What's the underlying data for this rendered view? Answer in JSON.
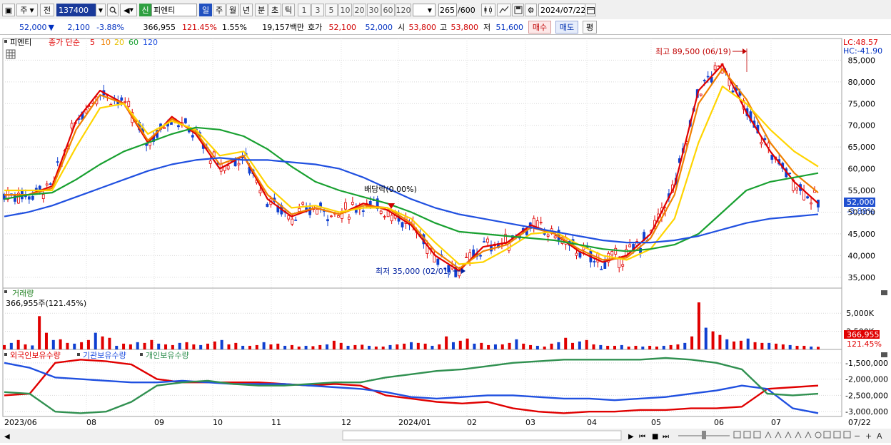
{
  "toolbar": {
    "market_label": "주",
    "prev_label": "전",
    "code_value": "137400",
    "sin_badge": "신",
    "name_value": "피엔티",
    "periods": [
      "일",
      "주",
      "월",
      "년",
      "분",
      "초",
      "틱"
    ],
    "intervals": [
      "1",
      "3",
      "5",
      "10",
      "20",
      "30",
      "60",
      "120"
    ],
    "count_value": "265",
    "count_total": "/600",
    "date_value": "2024/07/22"
  },
  "quote": {
    "price": "52,000",
    "change": "2,100",
    "change_pct": "-3.88%",
    "volume": "366,955",
    "volume_ratio": "121.45%",
    "turnover": "1.55%",
    "amount": "19,157백만",
    "ask_label": "호가",
    "ask_value": "52,100",
    "bid_value": "52,000",
    "open_label": "시",
    "open_value": "53,800",
    "high_label": "고",
    "high_value": "53,800",
    "low_label": "저",
    "low_value": "51,600",
    "buy_label": "매수",
    "sell_label": "매도",
    "eval_label": "평"
  },
  "price_panel": {
    "legend_name": "피엔티",
    "legend_ma": "종가 단순",
    "ma_periods": [
      "5",
      "10",
      "20",
      "60",
      "120"
    ],
    "ma_colors": [
      "#e00000",
      "#f08000",
      "#ffd400",
      "#18a030",
      "#2050e0"
    ],
    "lc_label": "LC:48.57",
    "hc_label": "HC:-41.90",
    "current_price_label": "52,000",
    "current_pct_label": "-3.88%",
    "high_annotation": "최고 89,500 (06/19)",
    "low_annotation": "최저 35,000 (02/01)",
    "dividend_annotation": "배당락(0.00%)"
  },
  "volume_panel": {
    "title": "거래량",
    "subtitle": "366,955주(121.45%)",
    "current_label": "366,955",
    "ratio_label": "121.45%"
  },
  "holding_panel": {
    "legend": [
      {
        "label": "외국인보유수량",
        "color": "#e00000"
      },
      {
        "label": "기관보유수량",
        "color": "#2050e0"
      },
      {
        "label": "개인보유수량",
        "color": "#309050"
      }
    ]
  },
  "chart_data": [
    {
      "type": "line",
      "title": "피엔티",
      "y_ticks": [
        35000,
        40000,
        45000,
        50000,
        55000,
        60000,
        65000,
        70000,
        75000,
        80000,
        85000
      ],
      "ylim": [
        32500,
        90000
      ],
      "x_labels": [
        "2023/06",
        "08",
        "09",
        "10",
        "11",
        "12",
        "2024/01",
        "02",
        "03",
        "04",
        "05",
        "06",
        "07",
        "07/22"
      ],
      "current_price": 52000,
      "period_high": 89500,
      "period_low": 35000,
      "series": [
        {
          "name": "5",
          "values": [
            54000,
            54000,
            56000,
            71000,
            78000,
            75000,
            66000,
            72000,
            68000,
            60000,
            63000,
            53000,
            49000,
            51000,
            49500,
            52000,
            50500,
            47000,
            40000,
            36500,
            42000,
            43000,
            47000,
            45000,
            41000,
            38500,
            40000,
            45000,
            56000,
            78000,
            84000,
            73000,
            64000,
            57000,
            52000
          ]
        },
        {
          "name": "10",
          "values": [
            54000,
            54000,
            55500,
            69000,
            77000,
            75000,
            66500,
            71500,
            68500,
            61000,
            63000,
            54000,
            49500,
            51000,
            49500,
            51500,
            51000,
            47500,
            41000,
            37000,
            41000,
            42500,
            46500,
            45000,
            41500,
            39000,
            39500,
            44000,
            54000,
            75000,
            83000,
            76000,
            66000,
            59000,
            54500
          ]
        },
        {
          "name": "20",
          "values": [
            55000,
            55000,
            55000,
            65000,
            74000,
            75000,
            68000,
            71000,
            69000,
            63000,
            64000,
            56000,
            51000,
            51500,
            50000,
            51000,
            51000,
            48500,
            43000,
            38000,
            38500,
            41500,
            45000,
            45500,
            42500,
            40000,
            39000,
            41500,
            48500,
            66000,
            79000,
            75000,
            69000,
            64000,
            60500
          ]
        },
        {
          "name": "60",
          "values": [
            53000,
            54000,
            54500,
            57500,
            61000,
            64000,
            66000,
            68000,
            69500,
            69000,
            67500,
            64500,
            60500,
            57000,
            55000,
            53500,
            52000,
            50000,
            47500,
            45500,
            45000,
            44500,
            44000,
            43500,
            42500,
            41500,
            41000,
            41500,
            42500,
            45000,
            50000,
            55000,
            57000,
            58000,
            59000
          ]
        },
        {
          "name": "120",
          "values": [
            49000,
            50000,
            51500,
            53500,
            55500,
            57500,
            59500,
            61000,
            62000,
            62500,
            62000,
            62000,
            61500,
            61000,
            60000,
            58000,
            55500,
            53000,
            51000,
            49500,
            48500,
            47500,
            46500,
            45500,
            44500,
            43500,
            43000,
            43000,
            43500,
            44500,
            46000,
            47500,
            48500,
            49000,
            49500
          ]
        }
      ]
    },
    {
      "type": "bar",
      "title": "거래량",
      "y_ticks": [
        "2,500K",
        "5,000K"
      ],
      "current_volume": 366955,
      "values": [
        600,
        900,
        1300,
        700,
        550,
        4600,
        2300,
        1300,
        1400,
        900,
        800,
        1000,
        1300,
        2300,
        1800,
        1600,
        500,
        800,
        700,
        1000,
        900,
        1300,
        800,
        700,
        600,
        900,
        1000,
        700,
        600,
        800,
        1100,
        1300,
        700,
        900,
        500,
        500,
        600,
        1000,
        700,
        800,
        500,
        600,
        400,
        500,
        450,
        600,
        700,
        1200,
        900,
        500,
        600,
        650,
        500,
        400,
        400,
        600,
        700,
        800,
        1000,
        900,
        800,
        500,
        700,
        1800,
        1000,
        1200,
        1500,
        800,
        900,
        600,
        700,
        700,
        900,
        1400,
        800,
        600,
        500,
        400,
        800,
        1000,
        1600,
        900,
        1100,
        1300,
        700,
        600,
        500,
        500,
        600,
        400,
        500,
        400,
        500,
        400,
        500,
        600,
        700,
        900,
        1800,
        6500,
        3000,
        2500,
        2000,
        1400,
        1100,
        1200,
        1500,
        1000,
        900,
        900,
        800,
        700,
        600,
        500,
        500,
        400,
        367
      ]
    },
    {
      "type": "line",
      "title": "보유수량",
      "y_ticks": [
        "-1,500,000",
        "-2,000,000",
        "-2,500,000",
        "-3,000,000"
      ],
      "series": [
        {
          "name": "외국인보유수량",
          "values": [
            -2500000,
            -2450000,
            -1500000,
            -1400000,
            -1450000,
            -1550000,
            -2000000,
            -2100000,
            -2100000,
            -2100000,
            -2100000,
            -2150000,
            -2200000,
            -2150000,
            -2200000,
            -2500000,
            -2600000,
            -2700000,
            -2750000,
            -2700000,
            -2900000,
            -3000000,
            -3050000,
            -3000000,
            -3000000,
            -2950000,
            -2950000,
            -2900000,
            -2900000,
            -2850000,
            -2300000,
            -2250000,
            -2200000
          ]
        },
        {
          "name": "기관보유수량",
          "values": [
            -1500000,
            -1650000,
            -1950000,
            -2000000,
            -2050000,
            -2100000,
            -2100000,
            -2050000,
            -2100000,
            -2150000,
            -2150000,
            -2150000,
            -2200000,
            -2250000,
            -2300000,
            -2400000,
            -2550000,
            -2600000,
            -2550000,
            -2500000,
            -2500000,
            -2550000,
            -2600000,
            -2600000,
            -2650000,
            -2600000,
            -2550000,
            -2450000,
            -2350000,
            -2200000,
            -2300000,
            -2900000,
            -3050000
          ]
        },
        {
          "name": "개인보유수량",
          "values": [
            -2400000,
            -2450000,
            -3000000,
            -3050000,
            -3000000,
            -2700000,
            -2200000,
            -2100000,
            -2050000,
            -2150000,
            -2200000,
            -2200000,
            -2150000,
            -2100000,
            -2100000,
            -1950000,
            -1850000,
            -1750000,
            -1700000,
            -1600000,
            -1500000,
            -1450000,
            -1400000,
            -1400000,
            -1400000,
            -1400000,
            -1350000,
            -1400000,
            -1500000,
            -1700000,
            -2450000,
            -2500000,
            -2450000
          ]
        }
      ]
    }
  ]
}
